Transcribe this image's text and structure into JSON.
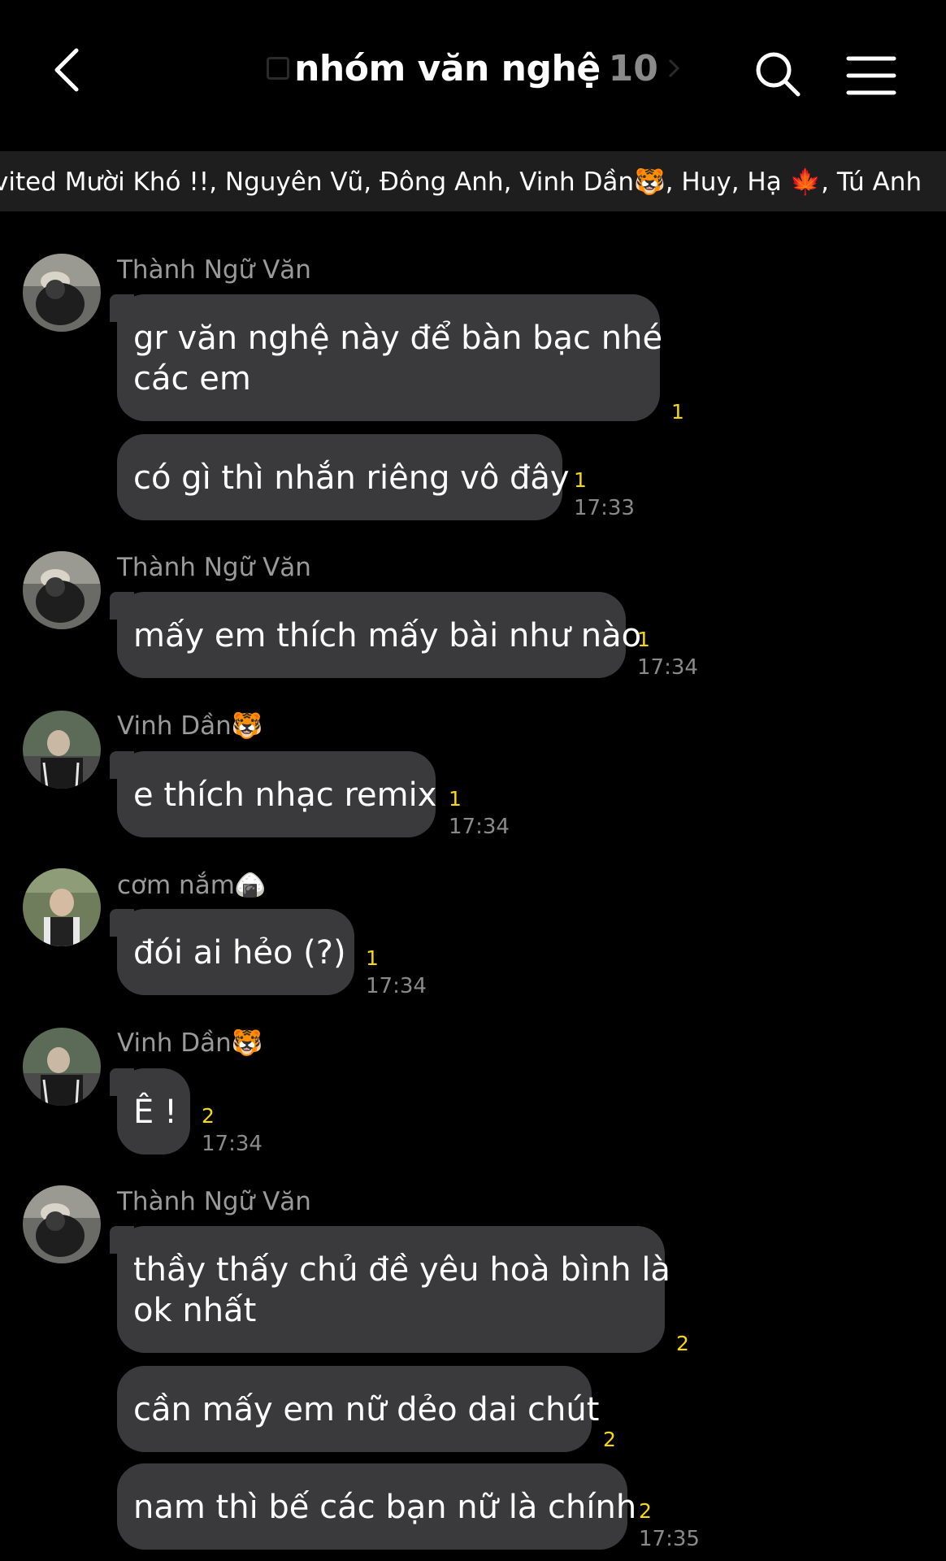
{
  "header": {
    "title": "nhóm văn nghệ",
    "member_count": "10"
  },
  "members_bar": {
    "text": "vited Mười Khó !!, Nguyên Vũ, Đông Anh, Vinh Dần🐯, Huy, Hạ 🍁, Tú Anh"
  },
  "messages": [
    {
      "sender": "Thành Ngữ Văn",
      "lines": [
        "gr văn nghệ này để bàn bạc nhé",
        "các em"
      ],
      "unread": "1",
      "time": ""
    },
    {
      "sender": "",
      "lines": [
        "có gì thì nhắn riêng vô đây"
      ],
      "unread": "1",
      "time": "17:33"
    },
    {
      "sender": "Thành Ngữ Văn",
      "lines": [
        "mấy em thích mấy bài như nào"
      ],
      "unread": "1",
      "time": "17:34"
    },
    {
      "sender": "Vinh Dần🐯",
      "lines": [
        "e thích nhạc remix"
      ],
      "unread": "1",
      "time": "17:34"
    },
    {
      "sender": "cơm nắm🍙",
      "lines": [
        "đói ai hẻo (?)"
      ],
      "unread": "1",
      "time": "17:34"
    },
    {
      "sender": "Vinh Dần🐯",
      "lines": [
        "Ê !"
      ],
      "unread": "2",
      "time": "17:34"
    },
    {
      "sender": "Thành Ngữ Văn",
      "lines": [
        "thầy thấy chủ đề yêu hoà bình là",
        "ok nhất"
      ],
      "unread": "2",
      "time": ""
    },
    {
      "sender": "",
      "lines": [
        "cần mấy em nữ dẻo dai chút"
      ],
      "unread": "2",
      "time": ""
    },
    {
      "sender": "",
      "lines": [
        "nam thì bế các bạn nữ là chính"
      ],
      "unread": "2",
      "time": "17:35"
    }
  ],
  "colors": {
    "background": "#000000",
    "bubble": "#3a3a3c",
    "unread": "#f5d90a",
    "meta_text": "#8a8a8a",
    "members_bar": "#1e1e1e"
  }
}
